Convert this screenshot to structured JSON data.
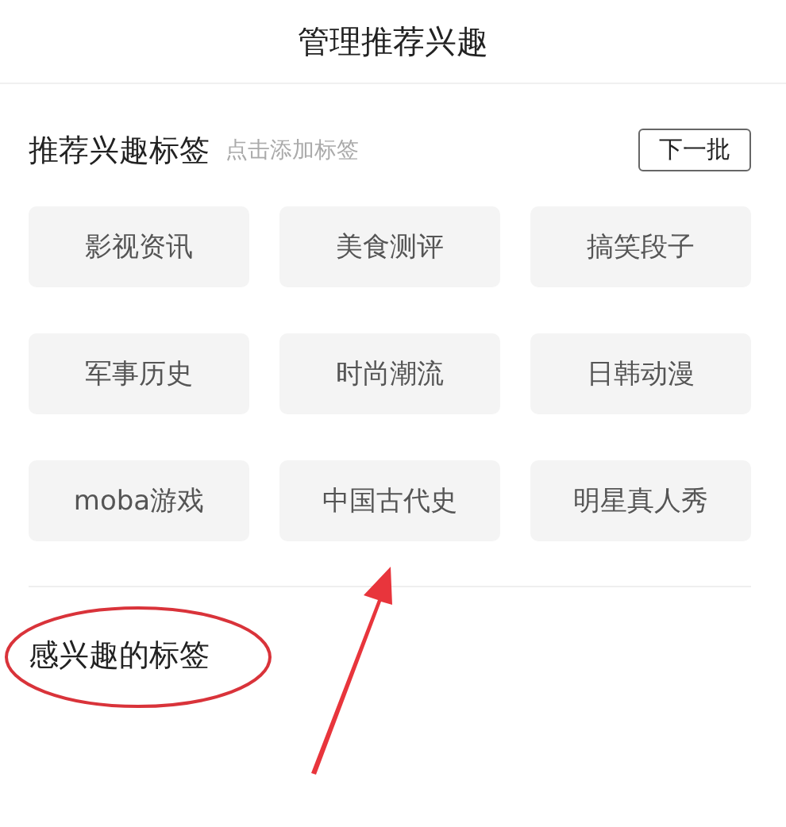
{
  "header": {
    "title": "管理推荐兴趣"
  },
  "recommended": {
    "title": "推荐兴趣标签",
    "hint": "点击添加标签",
    "next_button": "下一批",
    "tags": [
      "影视资讯",
      "美食测评",
      "搞笑段子",
      "军事历史",
      "时尚潮流",
      "日韩动漫",
      "moba游戏",
      "中国古代史",
      "明星真人秀"
    ]
  },
  "interested": {
    "title": "感兴趣的标签"
  }
}
